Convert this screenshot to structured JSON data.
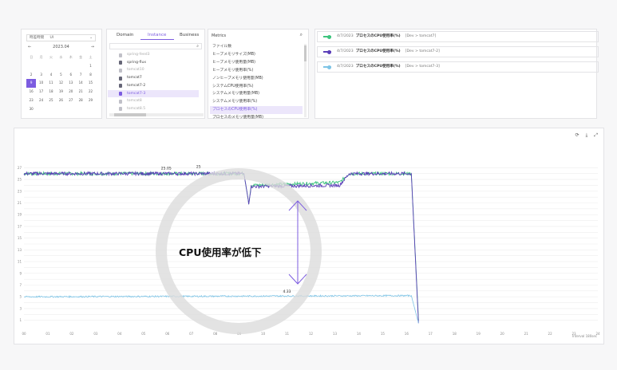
{
  "calendar": {
    "timezone_label": "時差時間",
    "timezone_value": "UI",
    "month": "2023.04",
    "weekdays": [
      "日",
      "月",
      "火",
      "水",
      "木",
      "金",
      "土"
    ],
    "days": [
      "",
      "",
      "",
      "",
      "",
      "",
      "1",
      "2",
      "3",
      "4",
      "5",
      "6",
      "7",
      "8",
      "9",
      "10",
      "11",
      "12",
      "13",
      "14",
      "15",
      "16",
      "17",
      "18",
      "19",
      "20",
      "21",
      "22",
      "23",
      "24",
      "25",
      "26",
      "27",
      "28",
      "29",
      "30"
    ],
    "selected_day": "9"
  },
  "tabs": [
    "Domain",
    "Instance",
    "Business"
  ],
  "active_tab": "Instance",
  "instances": [
    {
      "label": "spring-feed3",
      "color": "#c0c0c8",
      "dim": true
    },
    {
      "label": "spring-flux",
      "color": "#667",
      "dim": false
    },
    {
      "label": "tomcat10",
      "color": "#c0c0c8",
      "dim": true
    },
    {
      "label": "tomcat7",
      "color": "#667",
      "dim": false
    },
    {
      "label": "tomcat7-2",
      "color": "#667",
      "dim": false
    },
    {
      "label": "tomcat7-3",
      "color": "#7c5ce0",
      "dim": false,
      "selected": true
    },
    {
      "label": "tomcat8",
      "color": "#c0c0c8",
      "dim": true
    },
    {
      "label": "tomcat8.5",
      "color": "#c0c0c8",
      "dim": true
    }
  ],
  "metrics": {
    "title": "Metrics",
    "items": [
      "ファイル数",
      "ヒープメモリサイズ(MB)",
      "ヒープメモリ使用量(MB)",
      "ヒープメモリ使用率(%)",
      "ノンヒープメモリ使用量(MB)",
      "システムCPU使用率(%)",
      "システムメモリ使用量(MB)",
      "システムメモリ使用率(%)",
      "プロセスのCPU使用率(%)",
      "プロセスのメモリ使用量(MB)"
    ],
    "selected": "プロセスのCPU使用率(%)"
  },
  "series": [
    {
      "date": "4/7/2023",
      "name": "プロセスのCPU使用率(%)",
      "instance": "[Dev > tomcat7]",
      "color": "#3fc47f"
    },
    {
      "date": "4/7/2023",
      "name": "プロセスのCPU使用率(%)",
      "instance": "[Dev > tomcat7-2]",
      "color": "#5b3fb8"
    },
    {
      "date": "4/7/2023",
      "name": "プロセスのCPU使用率(%)",
      "instance": "[Dev > tomcat7-3]",
      "color": "#7ec4e6"
    }
  ],
  "chart_tools": [
    "⟳",
    "⤓",
    "⤢"
  ],
  "chart_data": {
    "type": "line",
    "y_ticks": [
      "1",
      "2",
      "3",
      "4",
      "5",
      "6",
      "7",
      "8",
      "9",
      "10",
      "11",
      "12",
      "13",
      "14",
      "15",
      "16",
      "17",
      "18",
      "19",
      "20",
      "21",
      "22",
      "23",
      "24",
      "25",
      "26",
      "27"
    ],
    "y_tick_labels_shown": [
      "1",
      "3",
      "5",
      "7",
      "9",
      "11",
      "13",
      "15",
      "17",
      "19",
      "21",
      "23",
      "25",
      "27"
    ],
    "x_ticks": [
      "00",
      "01",
      "02",
      "03",
      "04",
      "05",
      "06",
      "07",
      "08",
      "09",
      "10",
      "11",
      "12",
      "13",
      "14",
      "15",
      "16",
      "17",
      "18",
      "19",
      "20",
      "21",
      "22",
      "23",
      "24"
    ],
    "xlabel": "Interval 180sec",
    "peak_labels": [
      "25.05",
      "25"
    ],
    "low_label": "4.33",
    "series": [
      {
        "segments": [
          [
            0,
            26
          ],
          [
            9.2,
            26
          ],
          [
            9.4,
            21
          ],
          [
            9.5,
            24
          ],
          [
            13.2,
            24.5
          ],
          [
            13.6,
            26
          ],
          [
            16.2,
            26
          ],
          [
            16.5,
            1
          ]
        ]
      },
      {
        "segments": [
          [
            0,
            26
          ],
          [
            9.2,
            26
          ],
          [
            9.4,
            21
          ],
          [
            9.5,
            23.8
          ],
          [
            13.2,
            24
          ],
          [
            13.6,
            26
          ],
          [
            16.2,
            26
          ],
          [
            16.5,
            0.5
          ]
        ]
      },
      {
        "segments": [
          [
            0,
            5
          ],
          [
            16.2,
            5.2
          ],
          [
            16.5,
            0.5
          ]
        ]
      }
    ]
  },
  "annotation": "CPU使用率が低下"
}
